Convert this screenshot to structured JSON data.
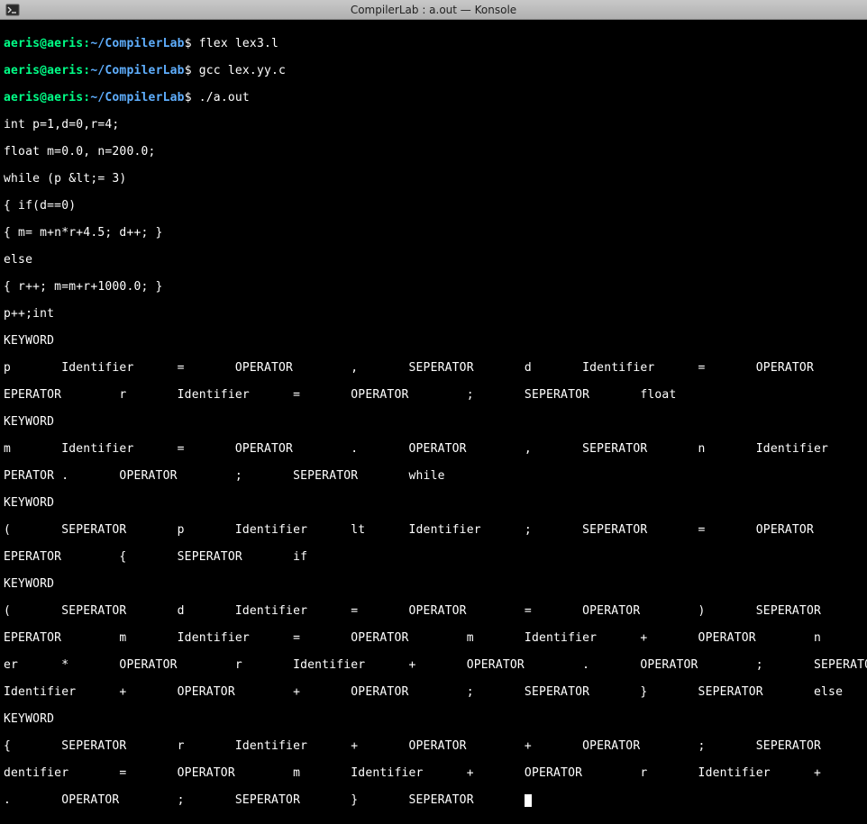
{
  "window": {
    "title": "CompilerLab : a.out — Konsole"
  },
  "prompt": {
    "user": "aeris@aeris",
    "sep1": ":",
    "path": "~/CompilerLab",
    "dollar": "$"
  },
  "commands": {
    "c1": "flex lex3.l",
    "c2": "gcc lex.yy.c",
    "c3": "./a.out"
  },
  "output": {
    "l01": "int p=1,d=0,r=4;",
    "l02": "float m=0.0, n=200.0;",
    "l03": "while (p &lt;= 3)",
    "l04": "{ if(d==0)",
    "l05": "{ m= m+n*r+4.5; d++; }",
    "l06": "else",
    "l07": "{ r++; m=m+r+1000.0; }",
    "l08": "p++;int",
    "l09": "KEYWORD",
    "l10": "p       Identifier      =       OPERATOR        ,       SEPERATOR       d       Identifier      =       OPERATOR        ,       S",
    "l11": "EPERATOR        r       Identifier      =       OPERATOR        ;       SEPERATOR       float",
    "l12": "KEYWORD",
    "l13": "m       Identifier      =       OPERATOR        .       OPERATOR        ,       SEPERATOR       n       Identifier      =       O",
    "l14": "PERATOR .       OPERATOR        ;       SEPERATOR       while",
    "l15": "KEYWORD",
    "l16": "(       SEPERATOR       p       Identifier      lt      Identifier      ;       SEPERATOR       =       OPERATOR        )       S",
    "l17": "EPERATOR        {       SEPERATOR       if",
    "l18": "KEYWORD",
    "l19": "(       SEPERATOR       d       Identifier      =       OPERATOR        =       OPERATOR        )       SEPERATOR       {       S",
    "l20": "EPERATOR        m       Identifier      =       OPERATOR        m       Identifier      +       OPERATOR        n       Identifi",
    "l21": "er      *       OPERATOR        r       Identifier      +       OPERATOR        .       OPERATOR        ;       SEPERATOR       d",
    "l22": "Identifier      +       OPERATOR        +       OPERATOR        ;       SEPERATOR       }       SEPERATOR       else",
    "l23": "KEYWORD",
    "l24": "{       SEPERATOR       r       Identifier      +       OPERATOR        +       OPERATOR        ;       SEPERATOR       m       I",
    "l25": "dentifier       =       OPERATOR        m       Identifier      +       OPERATOR        r       Identifier      +       OPERATOR",
    "l26": ".       OPERATOR        ;       SEPERATOR       }       SEPERATOR       "
  }
}
